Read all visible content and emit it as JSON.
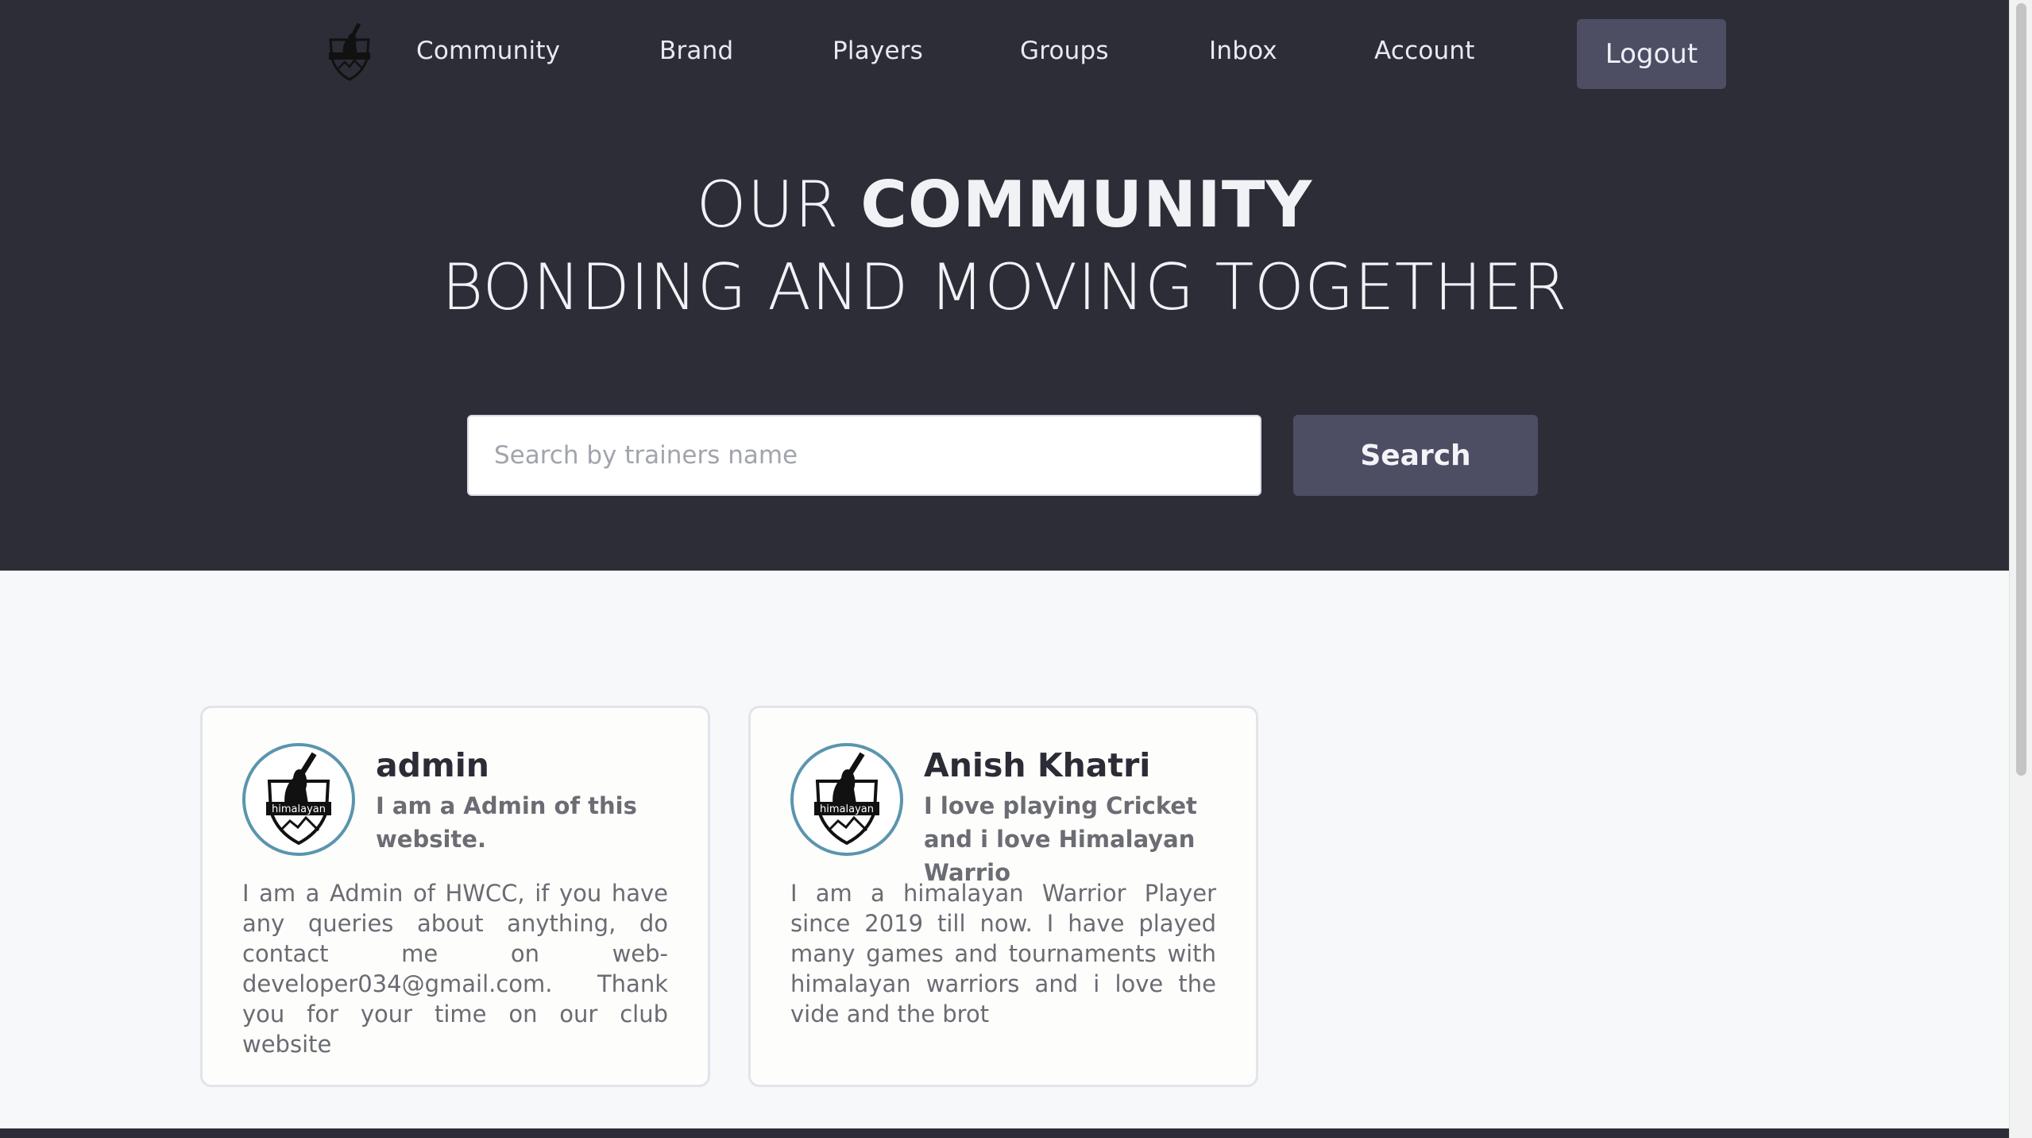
{
  "nav": {
    "logo_icon": "himalayan-warriors-logo-icon",
    "links": [
      "Community",
      "Brand",
      "Players",
      "Groups",
      "Inbox",
      "Account"
    ],
    "logout_label": "Logout"
  },
  "hero": {
    "title_light": "OUR ",
    "title_bold": "COMMUNITY",
    "subtitle": "BONDING AND MOVING TOGETHER"
  },
  "search": {
    "placeholder": "Search by trainers name",
    "value": "",
    "button_label": "Search"
  },
  "cards": [
    {
      "name": "admin",
      "tagline": "I am a Admin of this website.",
      "bio": "I am a Admin of HWCC, if you have any queries about anything, do contact me on web-developer034@gmail.com. Thank you for your time on our club website",
      "avatar_text": "himalayan"
    },
    {
      "name": "Anish Khatri",
      "tagline": "I love playing Cricket and i love Himalayan Warrio",
      "bio": "I am a himalayan Warrior Player since 2019 till now. I have played many games and tournaments with himalayan warriors and i love the vide and the brot",
      "avatar_text": "himalayan"
    }
  ],
  "colors": {
    "hero_bg": "#2c2d36",
    "button_bg": "#4d4e64",
    "page_bg": "#f7f8fa",
    "avatar_ring": "#5b95ae"
  }
}
